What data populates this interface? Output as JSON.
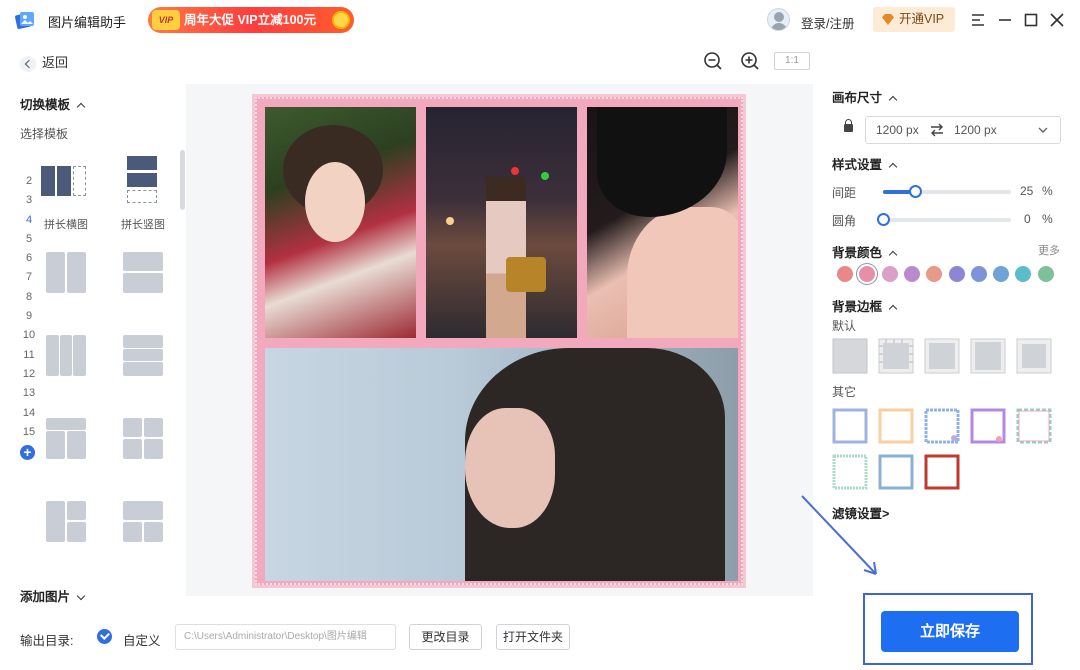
{
  "titlebar": {
    "app_title": "图片编辑助手",
    "promo_text": "周年大促 VIP立减100元",
    "promo_coin": "VIP",
    "login": "登录/注册",
    "vip_button": "开通VIP"
  },
  "toolbar": {
    "back": "返回",
    "ratio": "1:1"
  },
  "left_panel": {
    "switch_template": "切换模板",
    "select_template": "选择模板",
    "numbers": [
      "2",
      "3",
      "4",
      "5",
      "6",
      "7",
      "8",
      "9",
      "10",
      "11",
      "12",
      "13",
      "14",
      "15"
    ],
    "active_number": "4",
    "templates": [
      {
        "label": "拼长横图"
      },
      {
        "label": "拼长竖图"
      }
    ],
    "add_image": "添加图片"
  },
  "bottom": {
    "output_label": "输出目录:",
    "custom_label": "自定义",
    "path_value": "C:\\Users\\Administrator\\Desktop\\图片编辑",
    "change_dir": "更改目录",
    "open_folder": "打开文件夹"
  },
  "right_panel": {
    "canvas_size": "画布尺寸",
    "width": "1200 px",
    "height": "1200 px",
    "style_settings": "样式设置",
    "spacing_label": "间距",
    "spacing_value": "25",
    "spacing_fraction": 0.25,
    "radius_label": "圆角",
    "radius_value": "0",
    "radius_fraction": 0,
    "percent": "%",
    "bg_color": "背景颜色",
    "more": "更多",
    "swatches": [
      "#e88888",
      "#e78fa8",
      "#d9a0c8",
      "#b98ad0",
      "#e8998a",
      "#8d86d6",
      "#7f93d8",
      "#6fa3d8",
      "#5bbccb",
      "#7dc09a"
    ],
    "bg_border": "背景边框",
    "default_label": "默认",
    "other_label": "其它",
    "filter": "滤镜设置>",
    "save": "立即保存"
  },
  "colors": {
    "accent": "#1e6ef2",
    "collage_bg": "#f2a9bd"
  }
}
